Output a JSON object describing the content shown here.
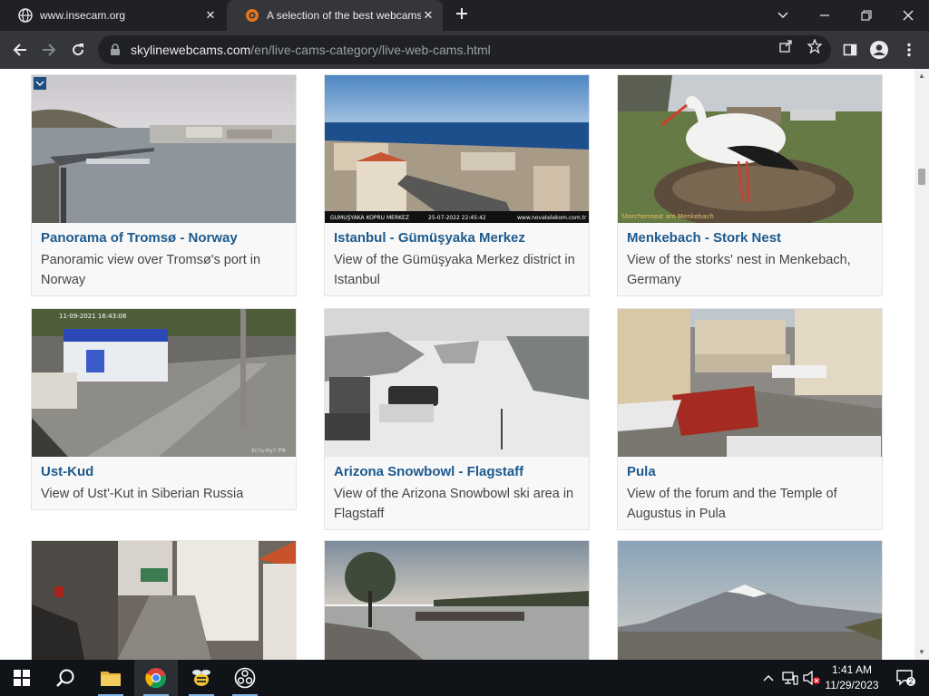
{
  "browser": {
    "tabs": [
      {
        "title": "www.insecam.org",
        "active": false
      },
      {
        "title": "A selection of the best webcams",
        "active": true
      }
    ],
    "url_host": "skylinewebcams.com",
    "url_path": "/en/live-cams-category/live-web-cams.html"
  },
  "webcams": [
    {
      "title": "Panorama of Tromsø - Norway",
      "description": "Panoramic view over Tromsø's port in Norway"
    },
    {
      "title": "Istanbul - Gümüşyaka Merkez",
      "description": "View of the Gümüşyaka Merkez district in Istanbul",
      "overlay_left": "GUMUŞYAKA KOPRU MERKEZ",
      "overlay_time": "25-07-2022 22:45:42",
      "overlay_right": "www.novatelekom.com.tr"
    },
    {
      "title": "Menkebach - Stork Nest",
      "description": "View of the storks' nest in Menkebach, Germany",
      "overlay_left": "Storchennest am Menkebach"
    },
    {
      "title": "Ust-Kud",
      "description": "View of Ust'-Kut in Siberian Russia",
      "overlay_left": "11-09-2021 16:43:08",
      "overlay_right": "Усть-Кут РФ"
    },
    {
      "title": "Arizona Snowbowl - Flagstaff",
      "description": "View of the Arizona Snowbowl ski area in Flagstaff"
    },
    {
      "title": "Pula",
      "description": "View of the forum and the Temple of Augustus in Pula"
    },
    {
      "title": "",
      "description": ""
    },
    {
      "title": "",
      "description": ""
    },
    {
      "title": "",
      "description": ""
    }
  ],
  "taskbar": {
    "time": "1:41 AM",
    "date": "11/29/2023",
    "notification_count": "2"
  },
  "colors": {
    "link": "#1d5a8e",
    "tab_bg": "#35363a",
    "taskbar_bg": "#101418"
  }
}
